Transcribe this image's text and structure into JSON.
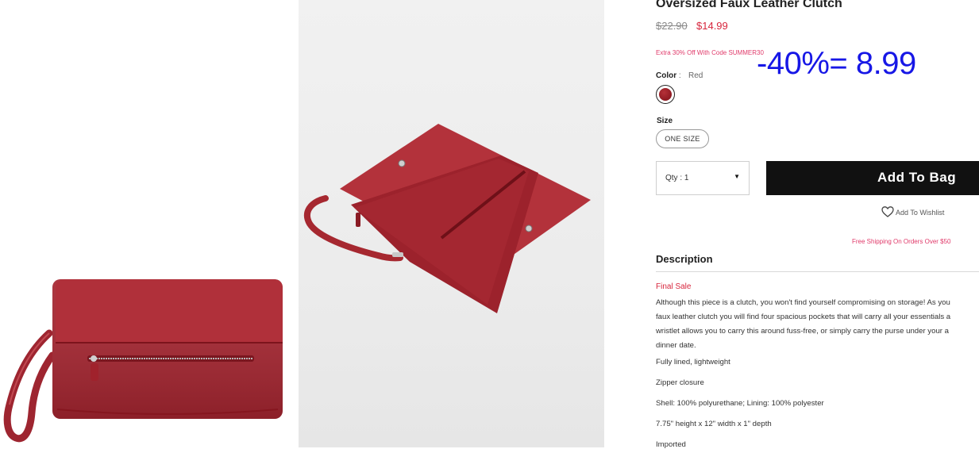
{
  "product": {
    "title": "Oversized Faux Leather Clutch",
    "original_price": "$22.90",
    "sale_price": "$14.99",
    "promo_text": "Extra 30% Off With Code SUMMER30",
    "annotation": "-40%= 8.99"
  },
  "color": {
    "label": "Color",
    "separator": ":",
    "value": "Red",
    "swatch": "#9b1f2a"
  },
  "size": {
    "label": "Size",
    "option": "ONE SIZE"
  },
  "quantity": {
    "label": "Qty : 1",
    "caret": "▼"
  },
  "actions": {
    "add_to_bag": "Add To Bag",
    "wishlist": "Add To Wishlist",
    "wishlist_icon": "heart-icon"
  },
  "shipping_note": "Free Shipping On Orders Over $50",
  "description": {
    "heading": "Description",
    "final_sale": "Final Sale",
    "body_lines": [
      "Although this piece is a clutch, you won't find yourself compromising on storage! As you",
      "faux leather clutch you will find four spacious pockets that will carry all your essentials a",
      "wristlet allows you to carry this around fuss-free, or simply carry the purse under your a",
      "dinner date."
    ],
    "details": [
      "Fully lined, lightweight",
      "Zipper closure",
      "Shell: 100% polyurethane; Lining: 100% polyester",
      "7.75\" height x 12\" width x 1\" depth",
      "Imported"
    ]
  },
  "colors": {
    "accent": "#d7263d",
    "promo": "#e03a6a",
    "button": "#111111",
    "annotation": "#1717e6"
  }
}
